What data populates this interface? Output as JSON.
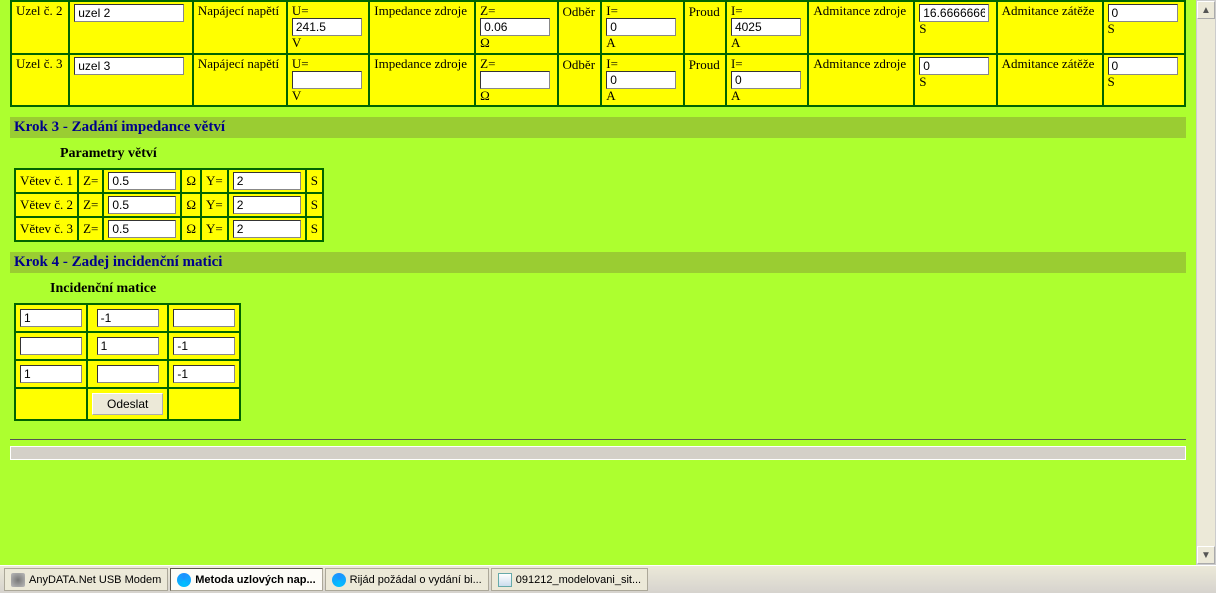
{
  "nodeTable": {
    "rows": [
      {
        "nodeLabel": "Uzel č. 2",
        "nodeName": "uzel 2",
        "supplyLabel": "Napájecí napětí",
        "U": "241.5",
        "impLabel": "Impedance zdroje",
        "Z": "0.06",
        "odberLabel": "Odběr",
        "I": "0",
        "proudLabel": "Proud",
        "I2": "4025",
        "admZLabel": "Admitance zdroje",
        "Y1": "16.6666666",
        "admLLabel": "Admitance zátěže",
        "Y2": "0"
      },
      {
        "nodeLabel": "Uzel č. 3",
        "nodeName": "uzel 3",
        "supplyLabel": "Napájecí napětí",
        "U": "",
        "impLabel": "Impedance zdroje",
        "Z": "",
        "odberLabel": "Odběr",
        "I": "0",
        "proudLabel": "Proud",
        "I2": "0",
        "admZLabel": "Admitance zdroje",
        "Y1": "0",
        "admLLabel": "Admitance zátěže",
        "Y2": "0"
      }
    ],
    "units": {
      "V": "V",
      "Ohm": "Ω",
      "A": "A",
      "S": "S"
    },
    "prefix": {
      "U": "U=",
      "Z": "Z=",
      "I": "I="
    }
  },
  "step3": {
    "title": "Krok 3 - Zadání impedance větví",
    "subtitle": "Parametry větví",
    "rows": [
      {
        "label": "Větev č. 1",
        "Z": "0.5",
        "Y": "2"
      },
      {
        "label": "Větev č. 2",
        "Z": "0.5",
        "Y": "2"
      },
      {
        "label": "Větev č. 3",
        "Z": "0.5",
        "Y": "2"
      }
    ],
    "Zlabel": "Z=",
    "Ylabel": "Y=",
    "Ohm": "Ω",
    "S": "S"
  },
  "step4": {
    "title": "Krok 4 - Zadej incidenční matici",
    "subtitle": "Incidenční matice",
    "matrix": [
      [
        "1",
        "-1",
        ""
      ],
      [
        "",
        "1",
        "-1"
      ],
      [
        "1",
        "",
        "-1"
      ]
    ],
    "submit": "Odeslat"
  },
  "taskbar": {
    "items": [
      {
        "label": "AnyDATA.Net USB Modem",
        "icon": "modem",
        "active": false
      },
      {
        "label": "Metoda uzlových nap...",
        "icon": "ie",
        "active": true
      },
      {
        "label": "Rijád požádal o vydání bi...",
        "icon": "ie",
        "active": false
      },
      {
        "label": "091212_modelovani_sit...",
        "icon": "doc",
        "active": false
      }
    ]
  }
}
